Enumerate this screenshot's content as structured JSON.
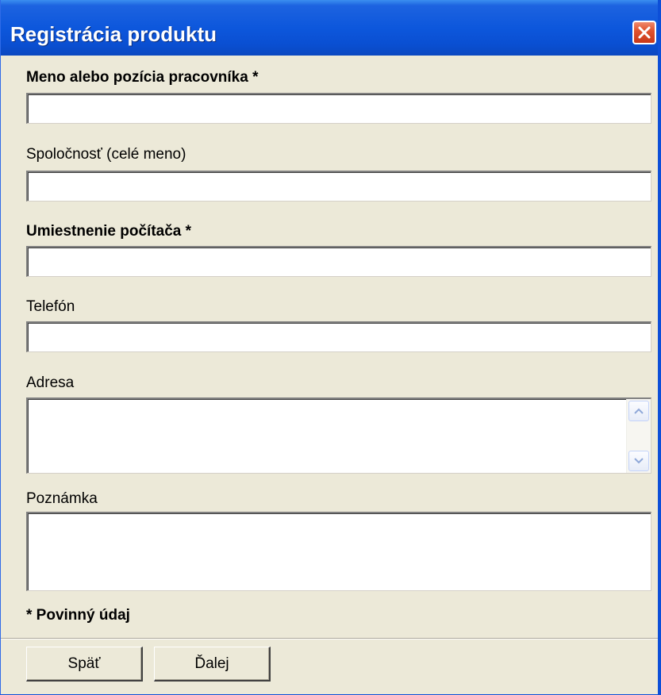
{
  "window": {
    "title": "Registrácia produktu"
  },
  "form": {
    "name_label": "Meno alebo pozícia pracovníka *",
    "name_value": "",
    "company_label": "Spoločnosť (celé meno)",
    "company_value": "",
    "location_label": "Umiestnenie počítača *",
    "location_value": "",
    "phone_label": "Telefón",
    "phone_value": "",
    "address_label": "Adresa",
    "address_value": "",
    "note_label": "Poznámka",
    "note_value": "",
    "required_note": "* Povinný údaj"
  },
  "buttons": {
    "back_label": "Späť",
    "next_label": "Ďalej"
  },
  "icons": {
    "close": "close-icon",
    "scroll_up": "chevron-up-icon",
    "scroll_down": "chevron-down-icon"
  },
  "colors": {
    "titlebar": "#0d57dc",
    "dialog_background": "#ece9d8",
    "close_button": "#e0542f"
  }
}
